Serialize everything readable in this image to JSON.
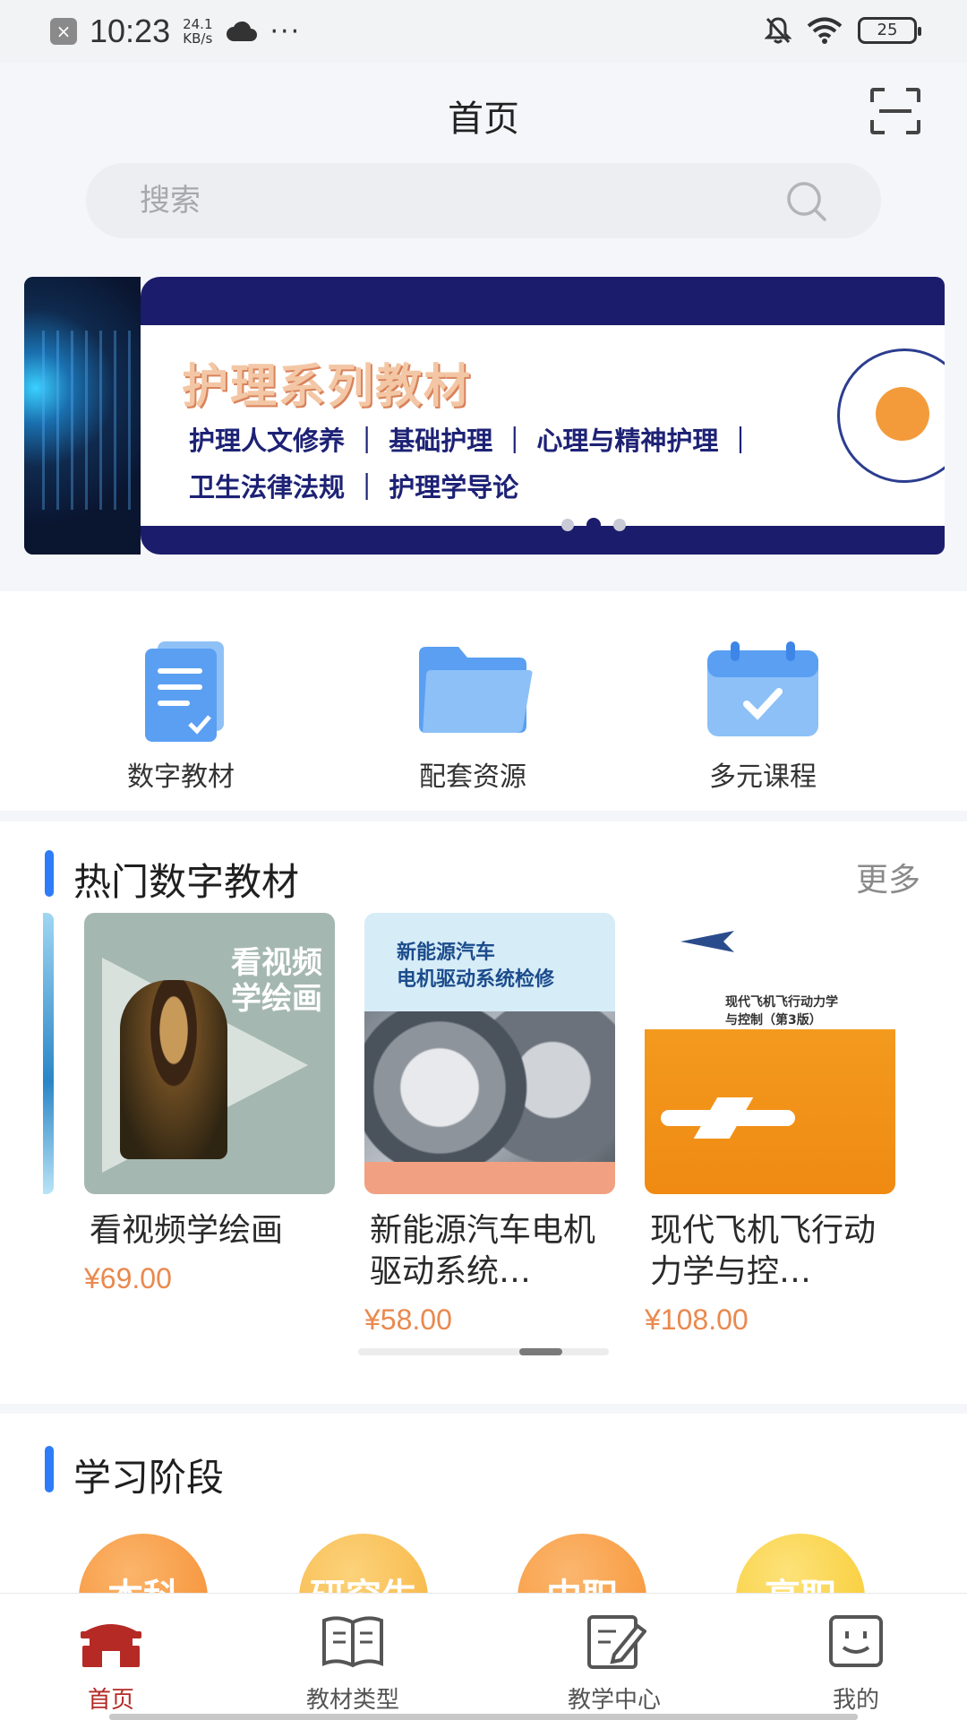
{
  "status_bar": {
    "time": "10:23",
    "speed_value": "24.1",
    "speed_unit": "KB/s",
    "battery": "25"
  },
  "header": {
    "title": "首页"
  },
  "search": {
    "placeholder": "搜索"
  },
  "banner": {
    "title": "护理系列教材",
    "line1": "护理人文修养 ｜ 基础护理 ｜ 心理与精神护理 ｜",
    "line2": "卫生法律法规 ｜ 护理学导论",
    "active_dot": 1,
    "dot_count": 3
  },
  "quick_entries": [
    {
      "label": "数字教材",
      "icon": "document-icon"
    },
    {
      "label": "配套资源",
      "icon": "folder-icon"
    },
    {
      "label": "多元课程",
      "icon": "calendar-check-icon"
    }
  ],
  "hot_books": {
    "title": "热门数字教材",
    "more": "更多",
    "items": [
      {
        "title": "看视频学绘画",
        "price": "¥69.00",
        "cover_text": "看视频\n学绘画"
      },
      {
        "title": "新能源汽车电机驱动系统…",
        "price": "¥58.00",
        "cover_text": "新能源汽车\n电机驱动系统检修"
      },
      {
        "title": "现代飞机飞行动力学与控…",
        "price": "¥108.00",
        "cover_text": "现代飞机飞行动力学\n与控制（第3版）"
      }
    ]
  },
  "stages": {
    "title": "学习阶段",
    "items": [
      {
        "label": "本科",
        "color": "#f58a2c"
      },
      {
        "label": "研究生",
        "color": "#f6b13b"
      },
      {
        "label": "中职",
        "color": "#f7902e"
      },
      {
        "label": "高职",
        "color": "#f7c826"
      }
    ]
  },
  "tab_bar": {
    "items": [
      {
        "label": "首页",
        "icon": "home-icon",
        "active": true
      },
      {
        "label": "教材类型",
        "icon": "book-icon",
        "active": false
      },
      {
        "label": "教学中心",
        "icon": "edit-icon",
        "active": false
      },
      {
        "label": "我的",
        "icon": "profile-icon",
        "active": false
      }
    ]
  },
  "colors": {
    "accent": "#2e7cf6",
    "price": "#e9894f",
    "active_tab": "#b52a25",
    "banner_navy": "#1b1c6b"
  }
}
